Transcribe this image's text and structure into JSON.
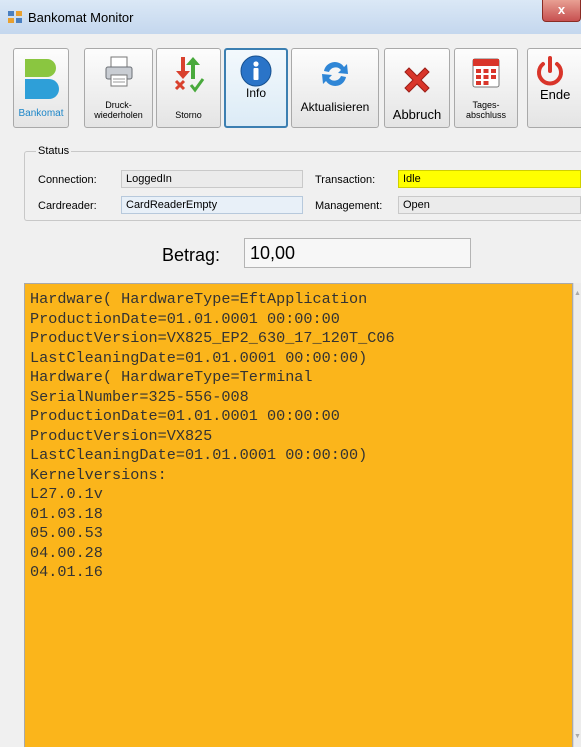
{
  "window": {
    "title": "Bankomat Monitor",
    "close_label": "x"
  },
  "toolbar": {
    "buttons": [
      {
        "id": "bankomat",
        "label": "Bankomat"
      },
      {
        "id": "druck",
        "label": "Druck-\nwiederholen"
      },
      {
        "id": "storno",
        "label": "Storno"
      },
      {
        "id": "info",
        "label": "Info"
      },
      {
        "id": "aktualisieren",
        "label": "Aktualisieren"
      },
      {
        "id": "abbruch",
        "label": "Abbruch"
      },
      {
        "id": "tagesabschluss",
        "label": "Tages-\nabschluss"
      },
      {
        "id": "ende",
        "label": "Ende"
      }
    ]
  },
  "status": {
    "group_label": "Status",
    "connection_label": "Connection:",
    "connection_value": "LoggedIn",
    "transaction_label": "Transaction:",
    "transaction_value": "Idle",
    "cardreader_label": "Cardreader:",
    "cardreader_value": "CardReaderEmpty",
    "management_label": "Management:",
    "management_value": "Open",
    "transaction_highlight": "#ffff00"
  },
  "betrag": {
    "label": "Betrag:",
    "value": "10,00"
  },
  "log": {
    "background": "#fbb51b",
    "lines": [
      "Hardware( HardwareType=EftApplication",
      "ProductionDate=01.01.0001 00:00:00",
      "ProductVersion=VX825_EP2_630_17_120T_C06",
      "LastCleaningDate=01.01.0001 00:00:00)",
      "Hardware( HardwareType=Terminal",
      "SerialNumber=325-556-008",
      "ProductionDate=01.01.0001 00:00:00",
      "ProductVersion=VX825",
      "LastCleaningDate=01.01.0001 00:00:00)",
      "Kernelversions:",
      "L27.0.1v",
      "01.03.18",
      "05.00.53",
      "04.00.28",
      "04.01.16"
    ]
  }
}
